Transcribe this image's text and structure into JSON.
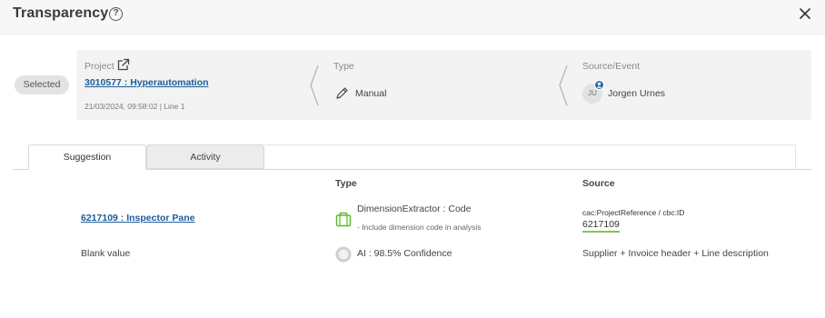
{
  "window": {
    "title": "Transparency"
  },
  "status": {
    "selected_label": "Selected"
  },
  "project": {
    "label": "Project",
    "link_text": "3010577 : Hyperautomation",
    "meta": "21/03/2024, 09:58:02 | Line 1"
  },
  "type": {
    "label": "Type",
    "value": "Manual"
  },
  "source_event": {
    "label": "Source/Event",
    "user_initials": "JU",
    "user_name": "Jorgen Urnes"
  },
  "tabs": [
    {
      "label": "Suggestion"
    },
    {
      "label": "Activity"
    }
  ],
  "table": {
    "headers": {
      "type": "Type",
      "source": "Source"
    },
    "row1": {
      "value": "6217109 : Inspector Pane",
      "type_title": "DimensionExtractor : Code",
      "type_note": "- Include dimension code in analysis",
      "source_path": "cac:ProjectReference / cbc:ID",
      "source_value": "6217109"
    },
    "row2": {
      "value": "Blank value",
      "type_title": "AI : 98.5% Confidence",
      "source_text": "Supplier + Invoice header + Line description"
    }
  },
  "colors": {
    "link": "#1d5c9a",
    "accent_green": "#7ec84a",
    "avatar_badge": "#2f6aa6"
  },
  "icons": [
    "help-icon",
    "close-icon",
    "external-link-icon",
    "pen-icon",
    "user-icon",
    "bag-icon",
    "ai-confidence-icon"
  ]
}
